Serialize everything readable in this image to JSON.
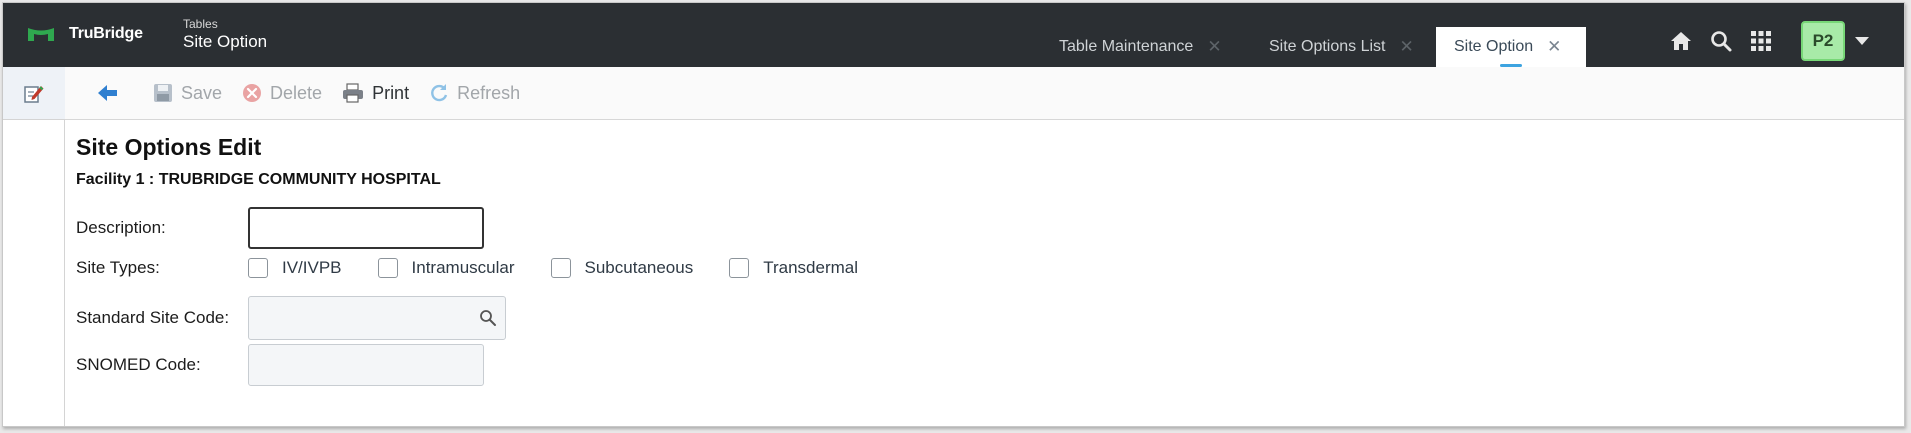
{
  "brand": {
    "name": "TruBridge",
    "accent": "#2fa84f"
  },
  "breadcrumb": {
    "parent": "Tables",
    "title": "Site Option"
  },
  "tabs": [
    {
      "label": "Table Maintenance",
      "active": false
    },
    {
      "label": "Site Options List",
      "active": false
    },
    {
      "label": "Site Option",
      "active": true
    }
  ],
  "header": {
    "avatar_label": "P2",
    "icons": [
      "home-icon",
      "search-icon",
      "apps-grid-icon",
      "chevron-down-icon"
    ]
  },
  "toolbar": {
    "back_icon": "back-arrow-icon",
    "save_label": "Save",
    "delete_label": "Delete",
    "print_label": "Print",
    "refresh_label": "Refresh"
  },
  "form": {
    "title": "Site Options Edit",
    "facility": "Facility 1 : TRUBRIDGE COMMUNITY HOSPITAL",
    "description_label": "Description:",
    "description_value": "",
    "site_types_label": "Site Types:",
    "site_types": [
      {
        "label": "IV/IVPB",
        "checked": false
      },
      {
        "label": "Intramuscular",
        "checked": false
      },
      {
        "label": "Subcutaneous",
        "checked": false
      },
      {
        "label": "Transdermal",
        "checked": false
      }
    ],
    "standard_site_code_label": "Standard Site Code:",
    "snomed_code_label": "SNOMED Code:"
  },
  "colors": {
    "header_bg": "#2b2f33",
    "active_tab_indicator": "#3da3e0",
    "avatar_bg": "#a8eaa8"
  }
}
